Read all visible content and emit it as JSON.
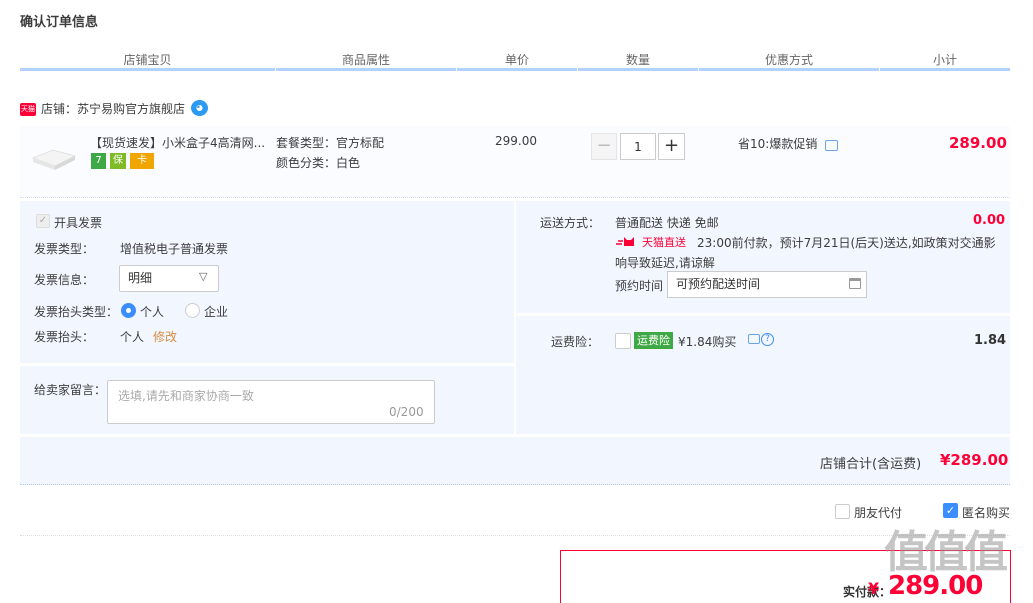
{
  "page_title": "确认订单信息",
  "columns": [
    "店铺宝贝",
    "商品属性",
    "单价",
    "数量",
    "优惠方式",
    "小计"
  ],
  "shop": {
    "badge": "天猫",
    "name_label": "店铺：苏宁易购官方旗舰店",
    "ww_icon": "chat-bubble"
  },
  "item": {
    "title": "【现货速发】小米盒子4高清网...",
    "service_icons": [
      "7",
      "保",
      "卡"
    ],
    "attrs": [
      "套餐类型：官方标配",
      "颜色分类：白色"
    ],
    "unit_price": "299.00",
    "quantity": "1",
    "minus_label": "−",
    "plus_label": "+",
    "promo": "省10:爆款促销",
    "subtotal": "289.00"
  },
  "invoice": {
    "checkbox_label": "开具发票",
    "type_label": "发票类型：",
    "type_value": "增值税电子普通发票",
    "info_label": "发票信息：",
    "info_value": "明细",
    "header_type_label": "发票抬头类型：",
    "opt_personal": "个人",
    "opt_company": "企业",
    "header_label": "发票抬头：",
    "header_value": "个人",
    "edit_link": "修改"
  },
  "message": {
    "label": "给卖家留言：",
    "placeholder": "选填,请先和商家协商一致",
    "counter": "0/200"
  },
  "shipping": {
    "label": "运送方式：",
    "method": "普通配送 快递 免邮",
    "fee": "0.00",
    "tmall_direct": "天猫直送",
    "notice_line1": "23:00前付款，预计7月21日(后天)送达,如政策对交通影",
    "notice_line2": "响导致延迟,请谅解",
    "schedule_label": "预约时间",
    "schedule_value": "可预约配送时间"
  },
  "insurance": {
    "label": "运费险：",
    "badge": "运费险",
    "price": "¥1.84购买",
    "fee": "1.84"
  },
  "shop_total": {
    "label": "店铺合计(含运费)",
    "value": "¥289.00"
  },
  "options": {
    "friend_pay": "朋友代付",
    "anonymous": "匿名购买"
  },
  "payment": {
    "label": "实付款：",
    "value": "289.00",
    "currency": "¥"
  },
  "watermark": "值值值",
  "colors": {
    "accent_red": "#ff0036",
    "header_blue": "#b2d1ff",
    "panel_bg": "#f2f7ff",
    "checkbox_blue": "#3c8dff"
  }
}
